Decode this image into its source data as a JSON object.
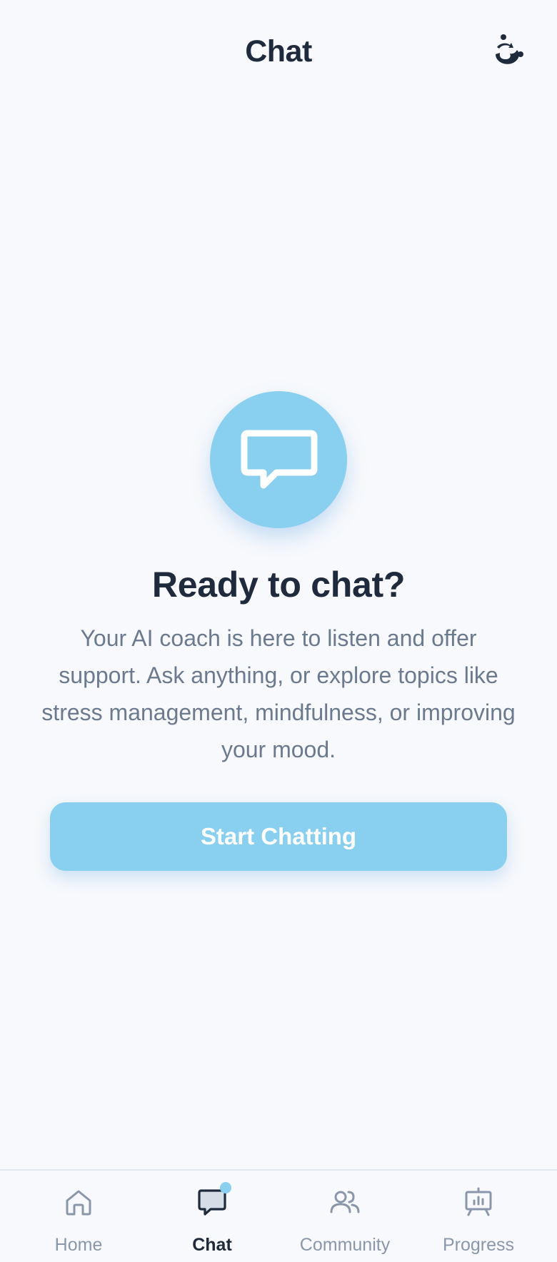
{
  "header": {
    "title": "Chat",
    "logo_icon": "brand-logo-icon"
  },
  "empty_state": {
    "icon": "chat-bubble-icon",
    "title": "Ready to chat?",
    "description": "Your AI coach is here to listen and offer support. Ask anything, or explore topics like stress management, mindfulness, or improving your mood.",
    "button_label": "Start Chatting"
  },
  "nav": {
    "items": [
      {
        "label": "Home",
        "icon": "home-icon",
        "active": false
      },
      {
        "label": "Chat",
        "icon": "chat-icon",
        "active": true,
        "has_notification": true
      },
      {
        "label": "Community",
        "icon": "community-icon",
        "active": false
      },
      {
        "label": "Progress",
        "icon": "progress-icon",
        "active": false
      }
    ]
  },
  "colors": {
    "background": "#f7f9fc",
    "accent": "#89cff0",
    "text_primary": "#1f2a3c",
    "text_secondary": "#6b7a8f",
    "nav_inactive": "#8a97ab"
  }
}
